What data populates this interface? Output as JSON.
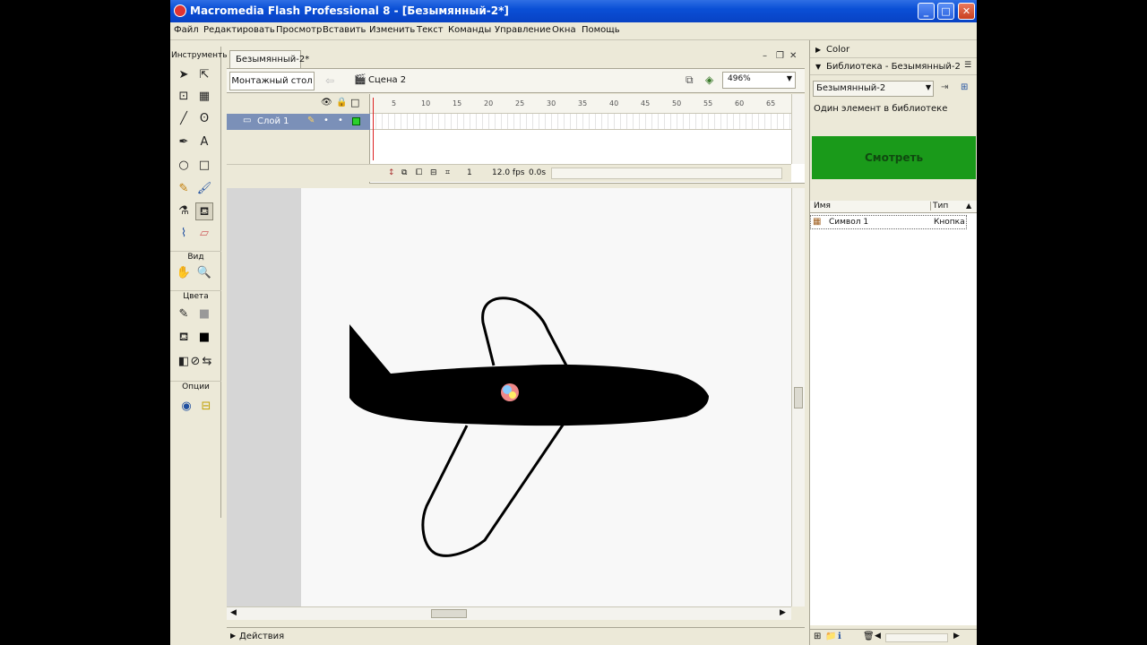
{
  "window": {
    "title": "Macromedia Flash Professional 8 - [Безымянный-2*]",
    "btn_min": "_",
    "btn_max": "□",
    "btn_close": "✕"
  },
  "menu": [
    "Файл",
    "Редактировать",
    "Просмотр",
    "Вставить",
    "Изменить",
    "Текст",
    "Команды",
    "Управление",
    "Окна",
    "Помощь"
  ],
  "tools": {
    "header": "Инструменты",
    "view_label": "Вид",
    "colors_label": "Цвета",
    "options_label": "Опции"
  },
  "document": {
    "tab": "Безымянный-2*",
    "min_ctl": "–",
    "max_ctl": "❐",
    "close_ctl": "✕",
    "stage_button": "Монтажный стол",
    "scene": "Сцена 2",
    "zoom": "496%"
  },
  "timeline": {
    "layer_name": "Слой 1",
    "ticks": [
      "5",
      "10",
      "15",
      "20",
      "25",
      "30",
      "35",
      "40",
      "45",
      "50",
      "55",
      "60",
      "65"
    ],
    "current_frame": "1",
    "fps": "12.0 fps",
    "time": "0.0s"
  },
  "bottom_panel": "Действия",
  "panels": {
    "color": "Color",
    "library_title": "Библиотека - Безымянный-2",
    "library_select": "Безымянный-2",
    "library_count": "Один элемент в библиотеке",
    "preview_label": "Смотреть",
    "col_name": "Имя",
    "col_type": "Тип",
    "item_name": "Символ 1",
    "item_type": "Кнопка"
  },
  "colors": {
    "titlebar": "#0a4fd6",
    "preview_bg": "#1a9a1a",
    "layer_selected": "#7b90b8",
    "playhead": "#dd2222"
  }
}
